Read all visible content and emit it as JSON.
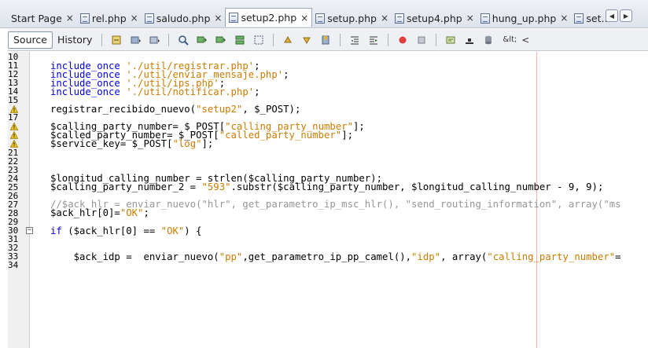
{
  "tabs": [
    {
      "label": "Start Page",
      "icon": "none",
      "active": false
    },
    {
      "label": "rel.php",
      "icon": "php-file-icon",
      "active": false
    },
    {
      "label": "saludo.php",
      "icon": "php-file-icon",
      "active": false
    },
    {
      "label": "setup2.php",
      "icon": "php-file-icon",
      "active": true
    },
    {
      "label": "setup.php",
      "icon": "php-file-icon",
      "active": false
    },
    {
      "label": "setup4.php",
      "icon": "php-file-icon",
      "active": false
    },
    {
      "label": "hung_up.php",
      "icon": "php-file-icon",
      "active": false
    },
    {
      "label": "set…",
      "icon": "php-file-icon",
      "active": false
    }
  ],
  "tab_close": "×",
  "tab_nav": {
    "left": "◀",
    "right": "▶"
  },
  "toolbar": {
    "source": "Source",
    "history": "History",
    "amp": "&lt;",
    "lt": "<"
  },
  "lines": [
    {
      "n": "10",
      "code": ""
    },
    {
      "n": "11",
      "code": "include_once './util/registrar.php';"
    },
    {
      "n": "12",
      "code": "include_once './util/enviar_mensaje.php';"
    },
    {
      "n": "13",
      "code": "include_once './util/ips.php';"
    },
    {
      "n": "14",
      "code": "include_once './util/notificar.php';"
    },
    {
      "n": "15",
      "code": ""
    },
    {
      "n": "16",
      "code": "registrar_recibido_nuevo(\"setup2\", $_POST);",
      "warn": true
    },
    {
      "n": "17",
      "code": ""
    },
    {
      "n": "18",
      "code": "$calling_party_number= $_POST[\"calling_party_number\"];",
      "warn": true
    },
    {
      "n": "19",
      "code": "$called_party_number= $_POST[\"called_party_number\"];",
      "warn": true
    },
    {
      "n": "20",
      "code": "$service_key= $_POST[\"log\"];",
      "warn": true
    },
    {
      "n": "21",
      "code": ""
    },
    {
      "n": "22",
      "code": ""
    },
    {
      "n": "23",
      "code": ""
    },
    {
      "n": "24",
      "code": "$longitud_calling_number = strlen($calling_party_number);"
    },
    {
      "n": "25",
      "code": "$calling_party_number_2 = \"593\".substr($calling_party_number, $longitud_calling_number - 9, 9);"
    },
    {
      "n": "26",
      "code": ""
    },
    {
      "n": "27",
      "code": "//$ack_hlr = enviar_nuevo(\"hlr\", get_parametro_ip_msc_hlr(), \"send_routing_information\", array(\"ms"
    },
    {
      "n": "28",
      "code": "$ack_hlr[0]=\"OK\";"
    },
    {
      "n": "29",
      "code": ""
    },
    {
      "n": "30",
      "code": "if ($ack_hlr[0] == \"OK\") {",
      "fold": true
    },
    {
      "n": "31",
      "code": ""
    },
    {
      "n": "32",
      "code": ""
    },
    {
      "n": "33",
      "code": "    $ack_idp =  enviar_nuevo(\"pp\",get_parametro_ip_pp_camel(),\"idp\", array(\"calling_party_number\"="
    },
    {
      "n": "34",
      "code": ""
    }
  ]
}
